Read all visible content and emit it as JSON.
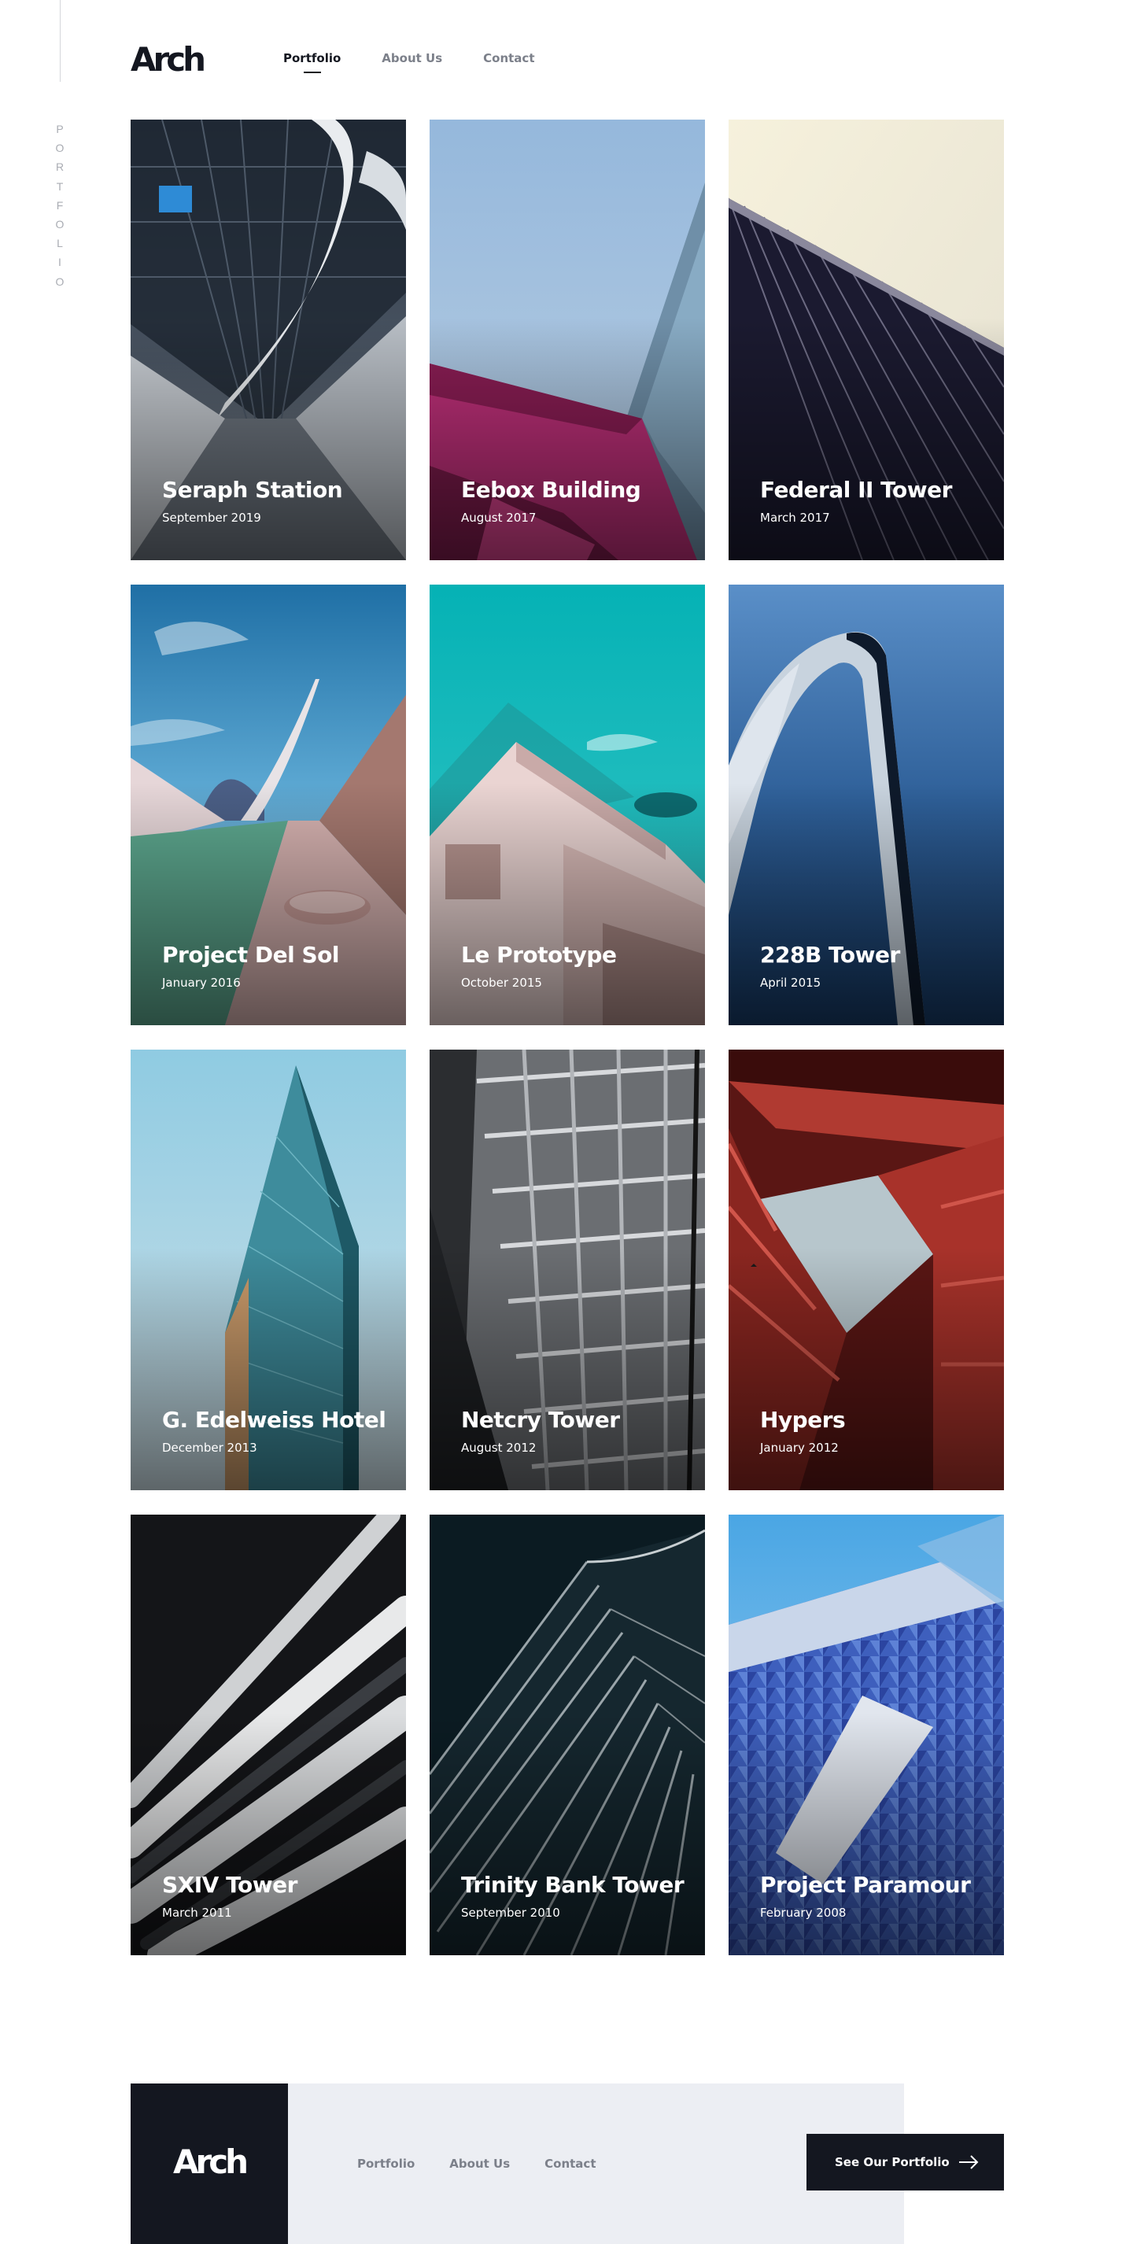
{
  "brand": {
    "logo_text": "Arch"
  },
  "side": {
    "label_letters": [
      "P",
      "O",
      "R",
      "T",
      "F",
      "O",
      "L",
      "I",
      "O"
    ]
  },
  "nav": [
    {
      "label": "Portfolio",
      "active": true
    },
    {
      "label": "About Us",
      "active": false
    },
    {
      "label": "Contact",
      "active": false
    }
  ],
  "projects": [
    {
      "title": "Seraph Station",
      "date": "September 2019"
    },
    {
      "title": "Eebox Building",
      "date": "August 2017"
    },
    {
      "title": "Federal II Tower",
      "date": "March 2017"
    },
    {
      "title": "Project Del Sol",
      "date": "January 2016"
    },
    {
      "title": "Le Prototype",
      "date": "October 2015"
    },
    {
      "title": "228B Tower",
      "date": "April 2015"
    },
    {
      "title": "G. Edelweiss Hotel",
      "date": "December 2013"
    },
    {
      "title": "Netcry Tower",
      "date": "August 2012"
    },
    {
      "title": "Hypers",
      "date": "January 2012"
    },
    {
      "title": "SXIV Tower",
      "date": "March 2011"
    },
    {
      "title": "Trinity Bank Tower",
      "date": "September 2010"
    },
    {
      "title": "Project Paramour",
      "date": "February 2008"
    }
  ],
  "footer": {
    "logo_text": "Arch",
    "nav": [
      "Portfolio",
      "About Us",
      "Contact"
    ],
    "cta_label": "See Our Portfolio"
  },
  "colors": {
    "ink": "#141720",
    "muted": "#7c808a",
    "footer_bg": "#eceef3"
  }
}
